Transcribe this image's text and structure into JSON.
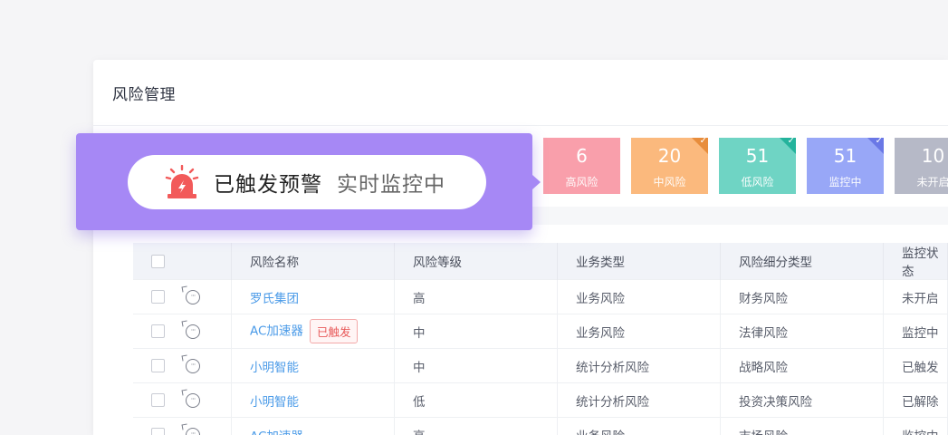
{
  "card": {
    "title": "风险管理"
  },
  "stats": [
    {
      "value": "6",
      "label": "高风险",
      "color": "#f99fab",
      "checked": false
    },
    {
      "value": "20",
      "label": "中风险",
      "color": "#fbb97d",
      "checked": true,
      "corner": "#e88d3c"
    },
    {
      "value": "51",
      "label": "低风险",
      "color": "#6fd4c4",
      "checked": true,
      "corner": "#24b39c"
    },
    {
      "value": "51",
      "label": "监控中",
      "color": "#98a7f7",
      "checked": true,
      "corner": "#6a78e6"
    },
    {
      "value": "10",
      "label": "未开启",
      "color": "#b6b9c7",
      "checked": false
    }
  ],
  "alert": {
    "main": "已触发预警",
    "sub": "实时监控中",
    "icon": "siren-icon",
    "accent": "#f25a5a"
  },
  "table": {
    "headers": [
      "风险名称",
      "风险等级",
      "业务类型",
      "风险细分类型",
      "监控状态"
    ],
    "rows": [
      {
        "name": "罗氏集团",
        "tag": "",
        "level": "高",
        "biz": "业务风险",
        "sub": "财务风险",
        "status": "未开启"
      },
      {
        "name": "AC加速器",
        "tag": "已触发",
        "level": "中",
        "biz": "业务风险",
        "sub": "法律风险",
        "status": "监控中"
      },
      {
        "name": "小明智能",
        "tag": "",
        "level": "中",
        "biz": "统计分析风险",
        "sub": "战略风险",
        "status": "已触发"
      },
      {
        "name": "小明智能",
        "tag": "",
        "level": "低",
        "biz": "统计分析风险",
        "sub": "投资决策风险",
        "status": "已解除"
      },
      {
        "name": "AC加速器",
        "tag": "",
        "level": "高",
        "biz": "业务风险",
        "sub": "市场风险",
        "status": "监控中"
      }
    ]
  }
}
